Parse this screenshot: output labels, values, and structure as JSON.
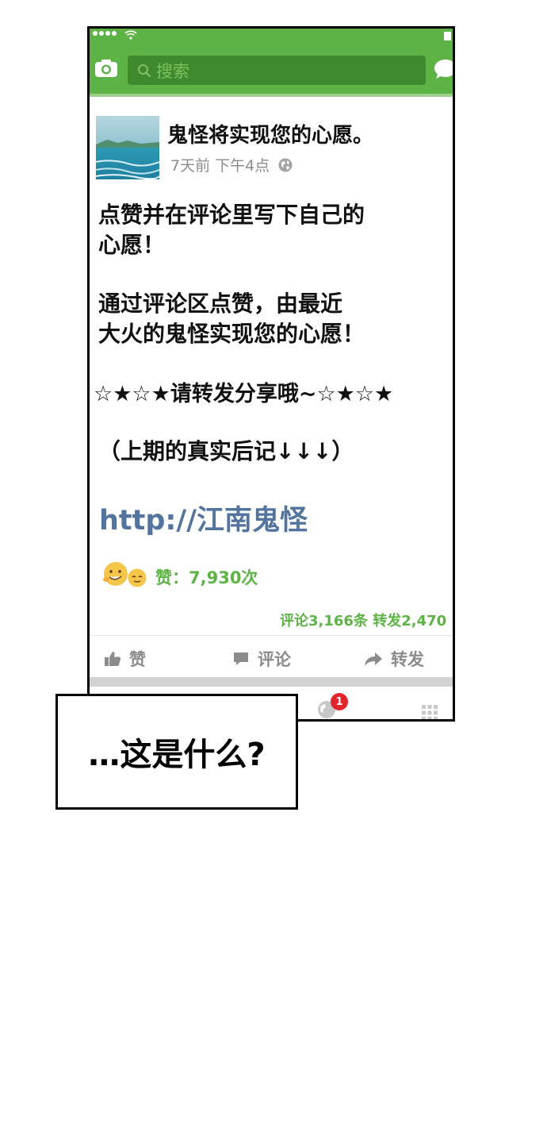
{
  "search": {
    "placeholder": "搜索"
  },
  "post": {
    "author": "鬼怪将实现您的心愿。",
    "time": "7天前 下午4点",
    "text_1_line_1": "点赞并在评论里写下自己的",
    "text_1_line_2": "心愿！",
    "text_2_line_1": "通过评论区点赞，由最近",
    "text_2_line_2": "大火的鬼怪实现您的心愿！",
    "text_3": "☆★☆★请转发分享哦~☆★☆★",
    "text_4": "（上期的真实后记↓↓↓）",
    "link": "http://江南鬼怪",
    "likes": "赞：7,930次",
    "comments_shares": "评论3,166条 转发2,470"
  },
  "actions": {
    "like": "赞",
    "comment": "评论",
    "share": "转发"
  },
  "tabbar": {
    "notification_badge": "1"
  },
  "speech_bubble": "…这是什么?",
  "colors": {
    "accent": "#5db345",
    "search_bg": "#3f8a2e",
    "link": "#53749f",
    "badge": "#e0262a"
  },
  "icons": [
    "wifi-icon",
    "battery-icon",
    "camera-icon",
    "search-icon",
    "chat-icon",
    "globe-icon",
    "thumbs-up-icon",
    "comment-icon",
    "share-icon",
    "grid-icon",
    "emoji-icon"
  ]
}
